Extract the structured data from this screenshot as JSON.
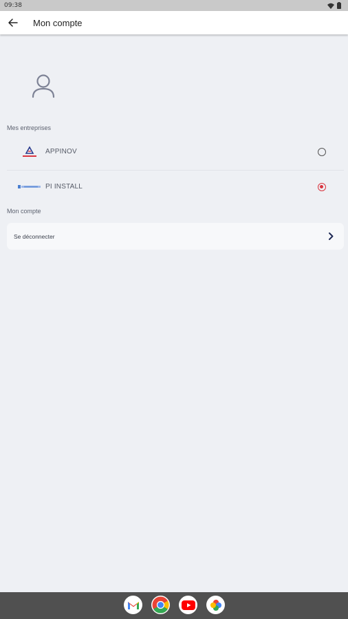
{
  "status_bar": {
    "time": "09:38"
  },
  "app_bar": {
    "title": "Mon compte"
  },
  "companies_section": {
    "label": "Mes entreprises",
    "items": [
      {
        "name": "APPINOV",
        "selected": false
      },
      {
        "name": "PI INSTALL",
        "selected": true
      }
    ]
  },
  "account_section": {
    "label": "Mon compte",
    "logout_label": "Se déconnecter"
  },
  "dock": {
    "apps": [
      "gmail-icon",
      "chrome-icon",
      "youtube-icon",
      "google-photos-icon"
    ]
  },
  "colors": {
    "background": "#eef0f4",
    "selected_radio": "#d9343e",
    "nav_bar": "#505050"
  }
}
